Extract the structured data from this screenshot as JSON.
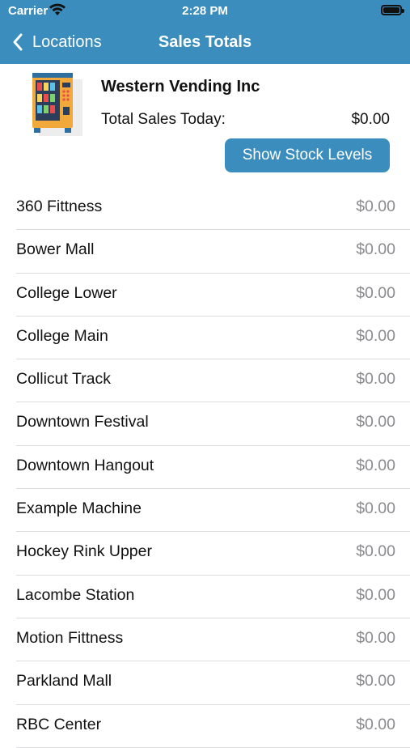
{
  "status": {
    "carrier": "Carrier",
    "time": "2:28 PM"
  },
  "nav": {
    "back_label": "Locations",
    "title": "Sales Totals"
  },
  "summary": {
    "company": "Western Vending Inc",
    "total_label": "Total Sales Today:",
    "total_value": "$0.00",
    "stock_button": "Show Stock Levels"
  },
  "locations": [
    {
      "name": "360 Fittness",
      "amount": "$0.00"
    },
    {
      "name": "Bower Mall",
      "amount": "$0.00"
    },
    {
      "name": "College Lower",
      "amount": "$0.00"
    },
    {
      "name": "College Main",
      "amount": "$0.00"
    },
    {
      "name": "Collicut Track",
      "amount": "$0.00"
    },
    {
      "name": "Downtown Festival",
      "amount": "$0.00"
    },
    {
      "name": "Downtown Hangout",
      "amount": "$0.00"
    },
    {
      "name": "Example Machine",
      "amount": "$0.00"
    },
    {
      "name": "Hockey Rink Upper",
      "amount": "$0.00"
    },
    {
      "name": "Lacombe Station",
      "amount": "$0.00"
    },
    {
      "name": "Motion Fittness",
      "amount": "$0.00"
    },
    {
      "name": "Parkland Mall",
      "amount": "$0.00"
    },
    {
      "name": "RBC Center",
      "amount": "$0.00"
    }
  ],
  "colors": {
    "accent": "#3a8dbd",
    "secondary_text": "#8a8a8f"
  },
  "icons": [
    "wifi-icon",
    "battery-icon",
    "back-chevron-icon",
    "vending-machine-icon"
  ]
}
